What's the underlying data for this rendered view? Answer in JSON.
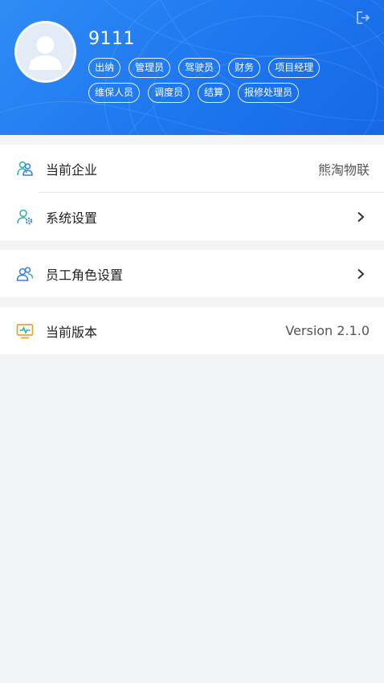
{
  "profile": {
    "username": "9111",
    "roles": [
      "出纳",
      "管理员",
      "驾驶员",
      "财务",
      "项目经理",
      "维保人员",
      "调度员",
      "结算",
      "报修处理员"
    ]
  },
  "menu": {
    "company": {
      "label": "当前企业",
      "value": "熊淘物联"
    },
    "system_settings": {
      "label": "系统设置"
    },
    "role_settings": {
      "label": "员工角色设置"
    },
    "version": {
      "label": "当前版本",
      "value": "Version 2.1.0"
    }
  },
  "colors": {
    "header_blue": "#1f78ef",
    "icon_blue": "#3d7fe0",
    "icon_teal": "#26b8a6",
    "icon_orange": "#e8a23c",
    "background": "#f3f4f6"
  },
  "icons": {
    "logout": "logout-icon",
    "avatar": "user-avatar-icon",
    "company": "team-icon",
    "system_settings": "user-settings-icon",
    "role_settings": "users-icon",
    "version": "monitor-pulse-icon",
    "chevron": "chevron-right-icon"
  }
}
